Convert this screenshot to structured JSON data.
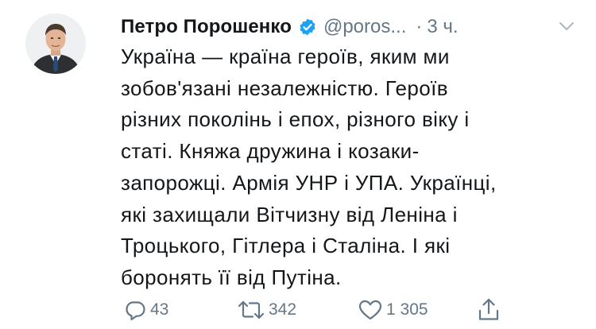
{
  "author": {
    "name": "Петро Порошенко",
    "handle": "@poros...",
    "verified": true
  },
  "meta": {
    "separator": "·",
    "time": "3 ч."
  },
  "tweet": {
    "text": "Україна — країна героїв, яким ми\nзобов'язані незалежністю. Героїв\nрізних поколінь і епох, різного віку і\nстаті. Княжа дружина і козаки-\nзапорожці. Армія УНР і УПА. Українці,\nякі захищали Вітчизну від Леніна і\nТроцького, Гітлера і Сталіна. І які\nборонять її від Путіна."
  },
  "actions": {
    "reply_count": "43",
    "retweet_count": "342",
    "like_count": "1 305"
  },
  "icons": {
    "reply": "reply-icon",
    "retweet": "retweet-icon",
    "like": "heart-icon",
    "share": "share-icon",
    "verified": "verified-badge-icon",
    "menu": "chevron-down-icon"
  },
  "colors": {
    "text": "#14171a",
    "secondary": "#657786",
    "verified": "#1da1f2",
    "background": "#ffffff"
  }
}
